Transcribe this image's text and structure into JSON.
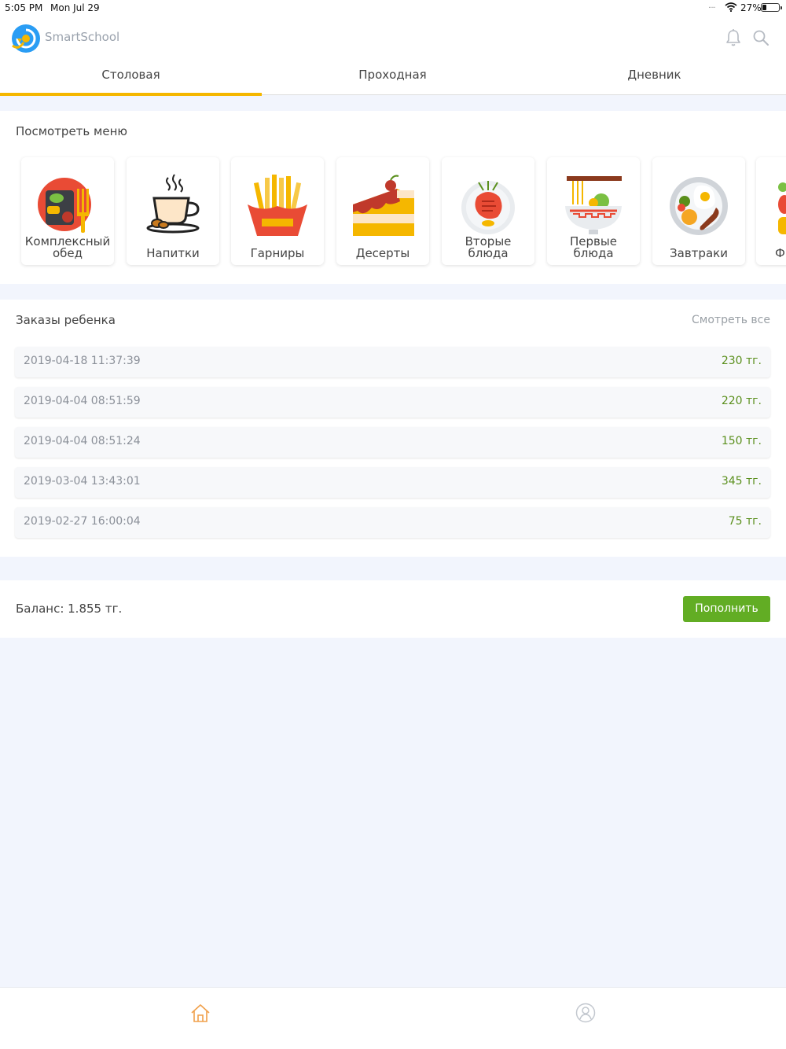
{
  "status_bar": {
    "time": "5:05 PM",
    "date": "Mon Jul 29",
    "signal": "....",
    "battery_percent": "27%",
    "battery_level": 0.27
  },
  "header": {
    "brand": "SmartSchool",
    "icons": [
      "notification-bell-icon",
      "search-icon"
    ]
  },
  "tabs": [
    {
      "label": "Столовая",
      "active": true
    },
    {
      "label": "Проходная",
      "active": false
    },
    {
      "label": "Дневник",
      "active": false
    }
  ],
  "menu": {
    "title": "Посмотреть меню",
    "categories": [
      {
        "label": "Комплексный обед",
        "icon": "complex-lunch-icon"
      },
      {
        "label": "Напитки",
        "icon": "coffee-cup-icon"
      },
      {
        "label": "Гарниры",
        "icon": "fries-icon"
      },
      {
        "label": "Десерты",
        "icon": "cake-icon"
      },
      {
        "label": "Вторые блюда",
        "icon": "main-dish-icon"
      },
      {
        "label": "Первые блюда",
        "icon": "soup-icon"
      },
      {
        "label": "Завтраки",
        "icon": "breakfast-icon"
      },
      {
        "label": "Ф",
        "icon": "vegetables-icon"
      }
    ]
  },
  "orders": {
    "title": "Заказы ребенка",
    "see_all": "Смотреть все",
    "items": [
      {
        "datetime": "2019-04-18 11:37:39",
        "amount": "230 тг."
      },
      {
        "datetime": "2019-04-04 08:51:59",
        "amount": "220 тг."
      },
      {
        "datetime": "2019-04-04 08:51:24",
        "amount": "150 тг."
      },
      {
        "datetime": "2019-03-04 13:43:01",
        "amount": "345 тг."
      },
      {
        "datetime": "2019-02-27 16:00:04",
        "amount": "75 тг."
      }
    ]
  },
  "balance": {
    "text": "Баланс: 1.855 тг.",
    "button": "Пополнить"
  },
  "bottom_nav": {
    "icons": [
      "home-icon",
      "profile-icon"
    ]
  },
  "colors": {
    "accent_tab": "#f5b700",
    "button_green": "#62ad24",
    "amount_green": "#5a8f1c",
    "page_bg": "#f2f5fd"
  }
}
